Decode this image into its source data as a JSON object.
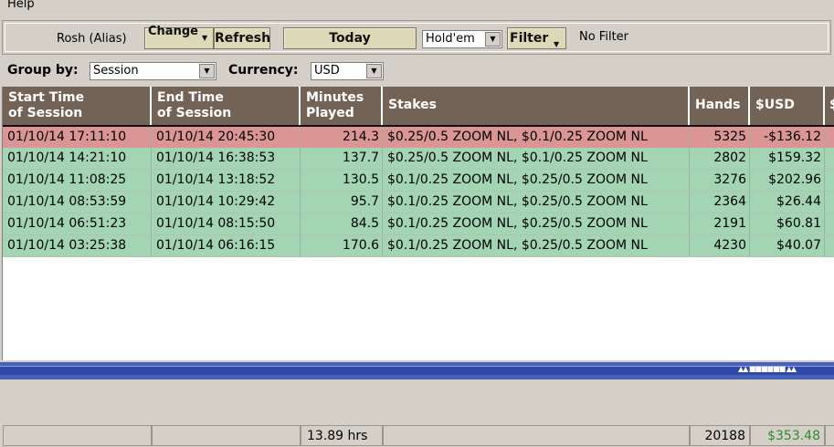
{
  "menu": {
    "help": "Help"
  },
  "toolbar": {
    "player": "Rosh (Alias)",
    "change_label": "Change",
    "refresh_label": "Refresh",
    "today_label": "Today",
    "game": "Hold'em",
    "filter_label": "Filter",
    "filter_status": "No Filter"
  },
  "options": {
    "group_by_label": "Group by:",
    "group_by_value": "Session",
    "currency_label": "Currency:",
    "currency_value": "USD"
  },
  "table": {
    "columns": [
      {
        "line1": "Start Time",
        "line2": "of Session"
      },
      {
        "line1": "End Time",
        "line2": "of Session"
      },
      {
        "line1": "Minutes",
        "line2": "Played"
      },
      {
        "line1": "Stakes",
        "line2": ""
      },
      {
        "line1": "Hands",
        "line2": ""
      },
      {
        "line1": "$USD",
        "line2": ""
      },
      {
        "line1": "$",
        "line2": ""
      }
    ],
    "rows": [
      {
        "start": "01/10/14 17:11:10",
        "end": "01/10/14 20:45:30",
        "minutes": "214.3",
        "stakes": "$0.25/0.5 ZOOM NL, $0.1/0.25 ZOOM NL",
        "hands": "5325",
        "usd": "-$136.12",
        "status": "loss"
      },
      {
        "start": "01/10/14 14:21:10",
        "end": "01/10/14 16:38:53",
        "minutes": "137.7",
        "stakes": "$0.25/0.5 ZOOM NL, $0.1/0.25 ZOOM NL",
        "hands": "2802",
        "usd": "$159.32",
        "status": "win"
      },
      {
        "start": "01/10/14 11:08:25",
        "end": "01/10/14 13:18:52",
        "minutes": "130.5",
        "stakes": "$0.1/0.25 ZOOM NL, $0.25/0.5 ZOOM NL",
        "hands": "3276",
        "usd": "$202.96",
        "status": "win"
      },
      {
        "start": "01/10/14 08:53:59",
        "end": "01/10/14 10:29:42",
        "minutes": "95.7",
        "stakes": "$0.1/0.25 ZOOM NL, $0.25/0.5 ZOOM NL",
        "hands": "2364",
        "usd": "$26.44",
        "status": "win"
      },
      {
        "start": "01/10/14 06:51:23",
        "end": "01/10/14 08:15:50",
        "minutes": "84.5",
        "stakes": "$0.1/0.25 ZOOM NL, $0.25/0.5 ZOOM NL",
        "hands": "2191",
        "usd": "$60.81",
        "status": "win"
      },
      {
        "start": "01/10/14 03:25:38",
        "end": "01/10/14 06:16:15",
        "minutes": "170.6",
        "stakes": "$0.1/0.25 ZOOM NL, $0.25/0.5 ZOOM NL",
        "hands": "4230",
        "usd": "$40.07",
        "status": "win"
      }
    ],
    "totals": {
      "minutes": "13.89 hrs",
      "hands": "20188",
      "usd": "$353.48"
    }
  },
  "colors": {
    "header": "#736357",
    "win_row": "#a3d4b4",
    "loss_row": "#dc9595",
    "total_positive": "#2e8b2e"
  }
}
